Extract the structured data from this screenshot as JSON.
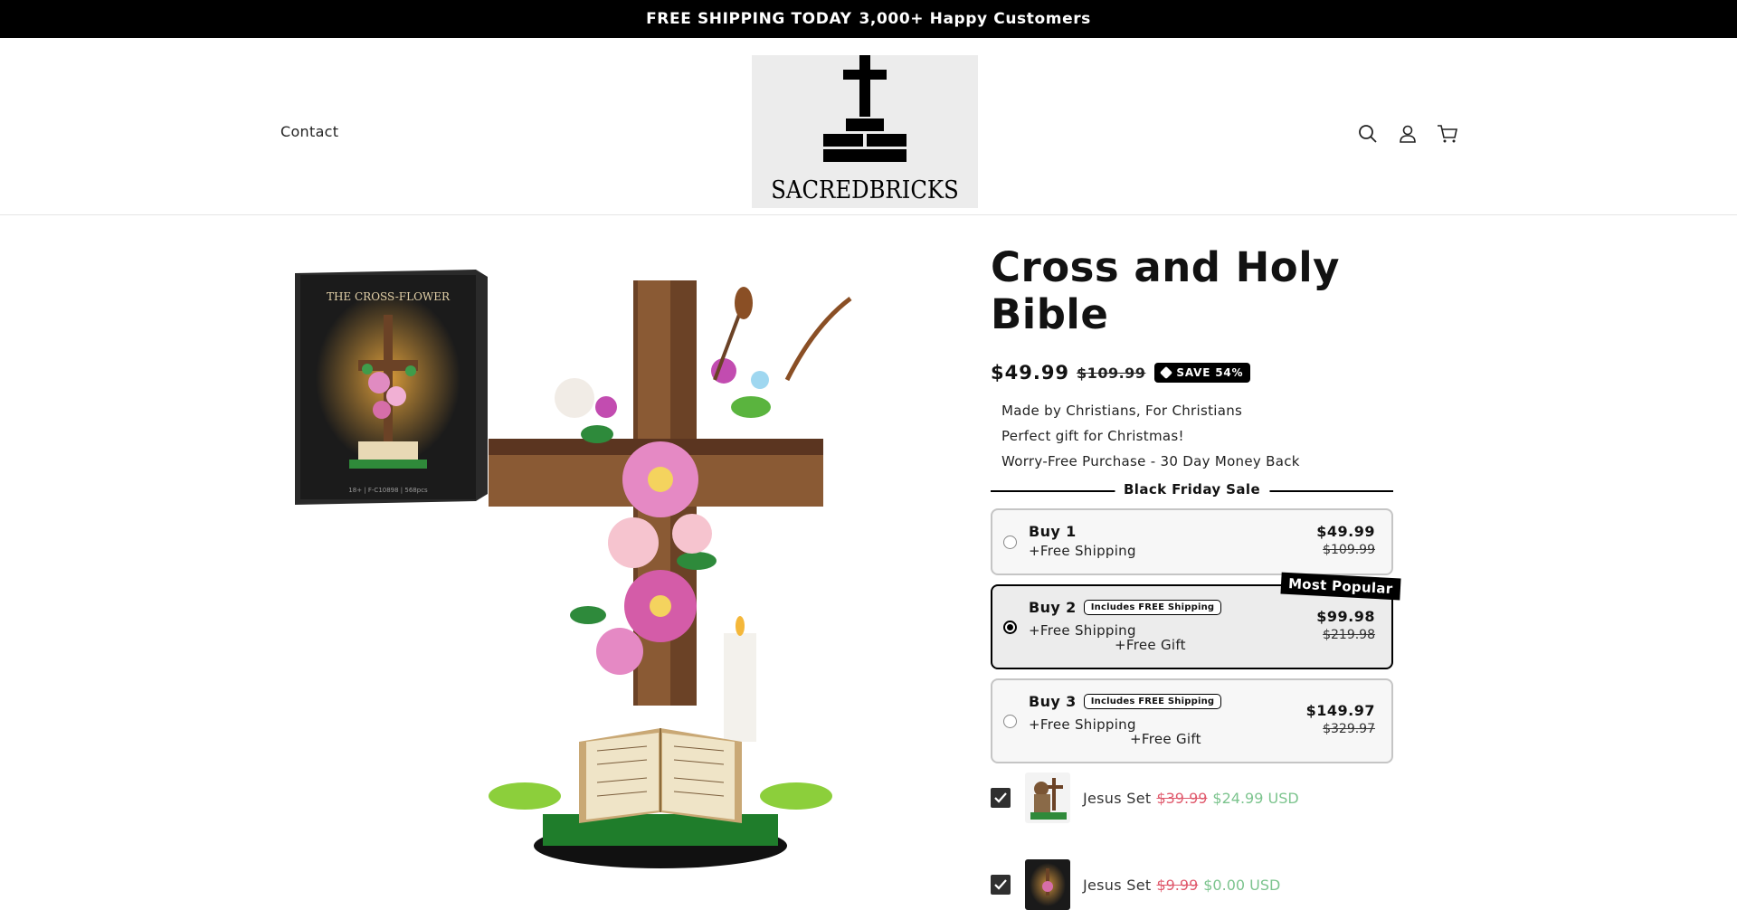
{
  "announcement": {
    "part1": "FREE SHIPPING TODAY",
    "part2": "3,000+ Happy Customers"
  },
  "header": {
    "nav_contact": "Contact",
    "logo_text": "SACREDBRICKS"
  },
  "gallery": {
    "box_title": "THE CROSS-FLOWER",
    "box_footer": "18+ | F-C10898 | 568pcs"
  },
  "product": {
    "title": "Cross and Holy Bible",
    "price": "$49.99",
    "compare_price": "$109.99",
    "save_badge": "SAVE 54%",
    "bullets": [
      "Made by Christians, For Christians",
      "Perfect gift for Christmas!",
      "Worry-Free Purchase - 30 Day Money Back"
    ],
    "sale_heading": "Black Friday Sale"
  },
  "bundles": [
    {
      "title": "Buy 1",
      "badge": "",
      "sub": "+Free Shipping",
      "gift": "",
      "price": "$49.99",
      "compare": "$109.99",
      "selected": false
    },
    {
      "title": "Buy 2",
      "badge": "Includes FREE Shipping",
      "sub": "+Free Shipping",
      "gift": "+Free Gift",
      "price": "$99.98",
      "compare": "$219.98",
      "selected": true,
      "ribbon": "Most Popular"
    },
    {
      "title": "Buy 3",
      "badge": "Includes FREE Shipping",
      "sub": "+Free Shipping",
      "gift": "+Free Gift",
      "price": "$149.97",
      "compare": "$329.97",
      "selected": false
    }
  ],
  "addons": [
    {
      "name": "Jesus Set",
      "old_price": "$39.99",
      "new_price": "$24.99 USD",
      "checked": true
    },
    {
      "name": "Jesus Set",
      "old_price": "$9.99",
      "new_price": "$0.00 USD",
      "checked": true
    }
  ],
  "colors": {
    "accent": "#000000",
    "old_price": "#e05a6d",
    "new_price": "#7cc48e"
  }
}
